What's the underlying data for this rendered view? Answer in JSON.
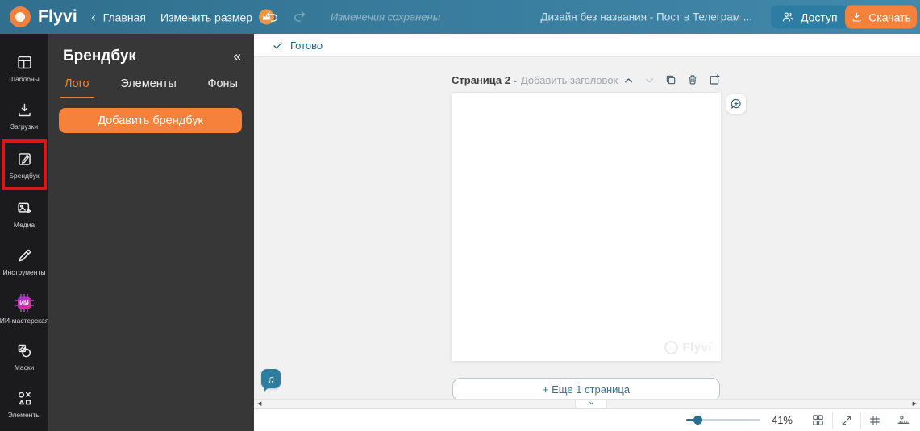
{
  "colors": {
    "accent_orange": "#f5823c",
    "topbar_teal": "#3a7e9f",
    "accent_teal": "#2e7191",
    "highlight_red": "#d81717",
    "ai_gradient_start": "#9b30e0",
    "ai_gradient_end": "#ee2b8e"
  },
  "topbar": {
    "logo_text": "Flyvi",
    "back_label": "Главная",
    "resize_label": "Изменить размер",
    "saved_status": "Изменения сохранены",
    "design_title": "Дизайн без названия - Пост в Телеграм ...",
    "access_label": "Доступ",
    "download_label": "Скачать"
  },
  "rail": {
    "ai_chip_text": "ИИ",
    "items": [
      {
        "label": "Шаблоны",
        "icon": "templates-icon",
        "highlighted": false
      },
      {
        "label": "Загрузки",
        "icon": "uploads-icon",
        "highlighted": false
      },
      {
        "label": "Брендбук",
        "icon": "brandbook-icon",
        "highlighted": true
      },
      {
        "label": "Медиа",
        "icon": "media-icon",
        "highlighted": false
      },
      {
        "label": "Инструменты",
        "icon": "tools-icon",
        "highlighted": false
      },
      {
        "label": "ИИ-мастерская",
        "icon": "ai-workshop-icon",
        "highlighted": false
      },
      {
        "label": "Маски",
        "icon": "masks-icon",
        "highlighted": false
      },
      {
        "label": "Элементы",
        "icon": "elements-icon",
        "highlighted": false
      }
    ]
  },
  "panel": {
    "title": "Брендбук",
    "tabs": [
      {
        "label": "Лого",
        "active": true
      },
      {
        "label": "Элементы",
        "active": false
      },
      {
        "label": "Фоны",
        "active": false
      }
    ],
    "add_button_label": "Добавить брендбук"
  },
  "canvas": {
    "status_label": "Готово",
    "page_title": "Страница 2 -",
    "page_title_placeholder": "Добавить заголовок",
    "watermark_text": "Flyvi",
    "add_page_label": "+ Еще 1 страница"
  },
  "bottombar": {
    "zoom_level": "41%"
  }
}
